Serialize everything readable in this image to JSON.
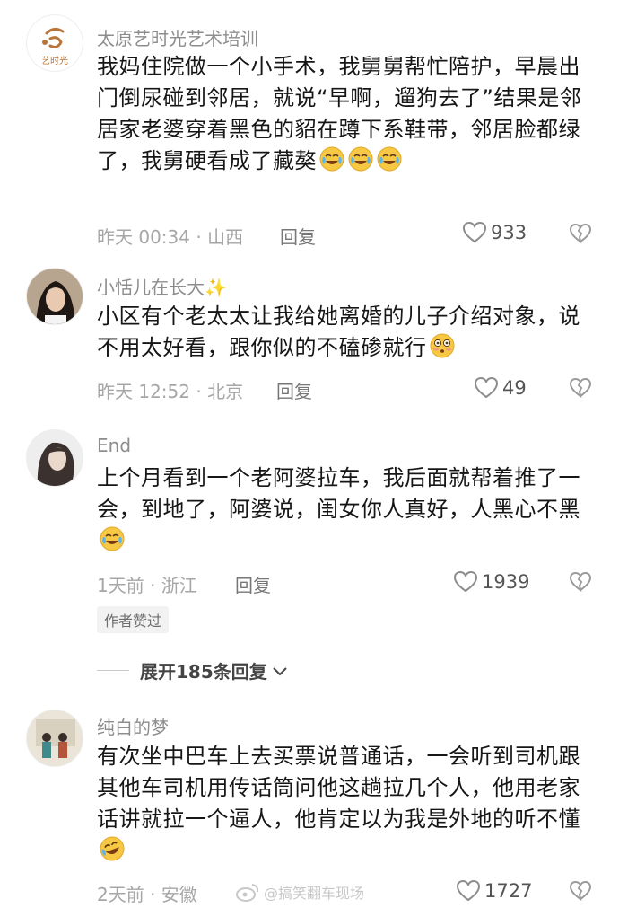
{
  "comments": [
    {
      "author": "太原艺时光艺术培训",
      "content": "我妈住院做一个小手术，我舅舅帮忙陪护，早晨出门倒尿碰到邻居，就说“早啊，遛狗去了”结果是邻居家老婆穿着黑色的貂在蹲下系鞋带，邻居脸都绿了，我舅硬看成了藏獒",
      "emoji": "crying-laughing-icon",
      "time_location": "昨天 00:34 · 山西",
      "reply_label": "回复",
      "likes": "933",
      "avatar_text": "艺时光"
    },
    {
      "author": "小恬儿在长大✨",
      "content": "小区有个老太太让我给她离婚的儿子介绍对象，说不用太好看，跟你似的不磕碜就行",
      "emoji": "flushed-icon",
      "time_location": "昨天 12:52 · 北京",
      "reply_label": "回复",
      "likes": "49"
    },
    {
      "author": "End",
      "content": "上个月看到一个老阿婆拉车，我后面就帮着推了一会，到地了，阿婆说，闺女你人真好，人黑心不黑",
      "emoji": "crying-laughing-icon",
      "time_location": "1天前 · 浙江",
      "reply_label": "回复",
      "likes": "1939",
      "tag": "作者赞过"
    },
    {
      "author": "纯白的梦",
      "content": "有次坐中巴车上去买票说普通话，一会听到司机跟其他车司机用传话筒问他这趟拉几个人，他用老家话讲就拉一个逼人，他肯定以为我是外地的听不懂",
      "emoji": "rofl-icon",
      "time_location": "2天前 · 安徽",
      "reply_label": "回复",
      "likes": "1727"
    }
  ],
  "expand_label": "展开185条回复",
  "watermark": "@搞笑翻车现场"
}
